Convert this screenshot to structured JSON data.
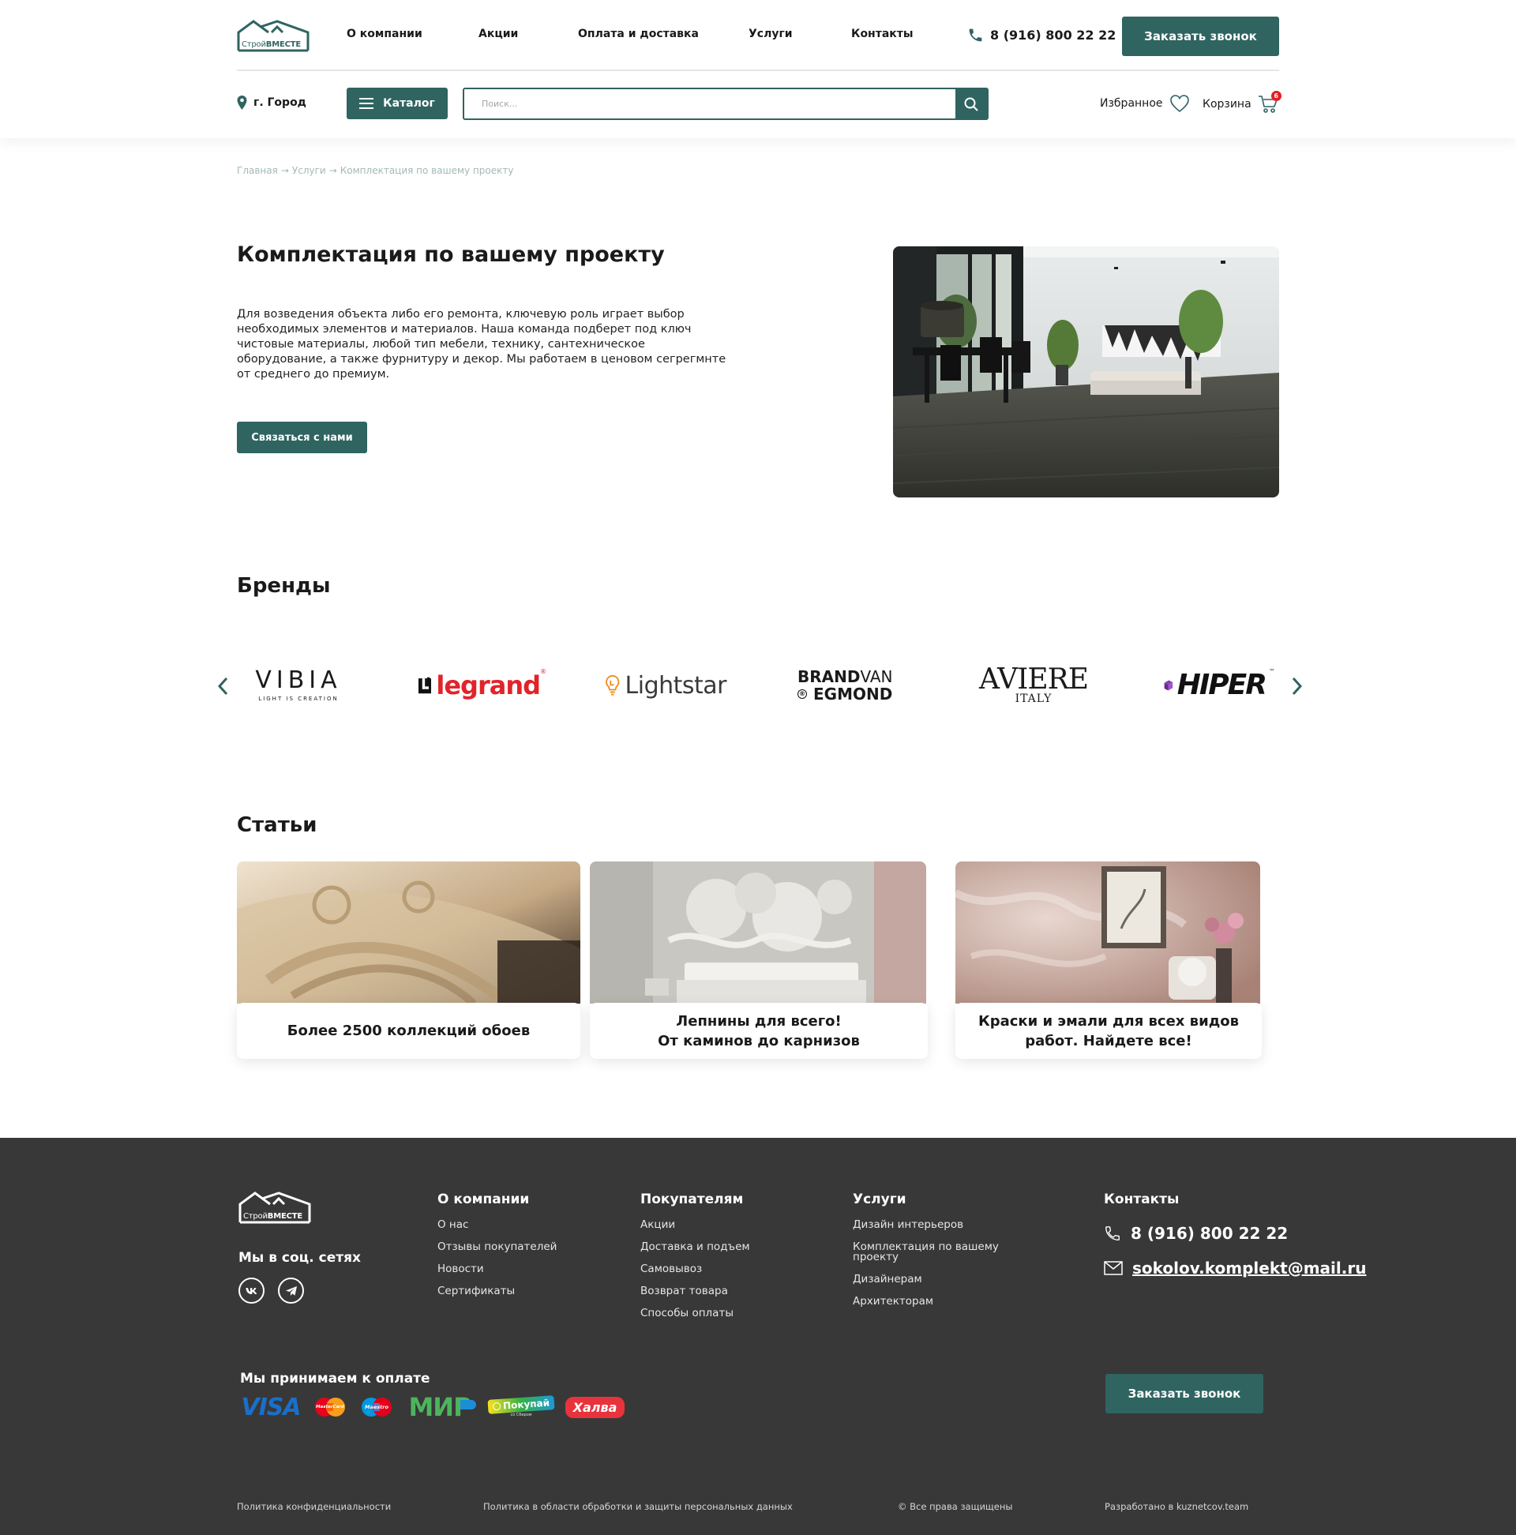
{
  "header": {
    "logo": {
      "part1": "Строй",
      "part2": "ВМЕСТЕ"
    },
    "nav": [
      "О компании",
      "Акции",
      "Оплата и доставка",
      "Услуги",
      "Контакты"
    ],
    "phone": "8 (916) 800 22 22",
    "callback_label": "Заказать звонок",
    "city": "г. Город",
    "catalog_label": "Каталог",
    "search_placeholder": "Поиск...",
    "favorites_label": "Избранное",
    "cart_label": "Корзина",
    "cart_count": "6"
  },
  "breadcrumb": {
    "home": "Главная",
    "sep": "→",
    "services": "Услуги",
    "current": "Комплектация по вашему проекту"
  },
  "hero": {
    "title": "Комплектация по вашему проекту",
    "text": "Для возведения объекта либо его ремонта, ключевую роль играет выбор необходимых элементов и материалов. Наша команда подберет под ключ чистовые материалы, любой тип мебели, технику, сантехническое оборудование, а также фурнитуру и декор. Мы работаем в ценовом сегрегмнте от среднего до премиум.",
    "button": "Связаться с нами"
  },
  "brands": {
    "title": "Бренды",
    "items": {
      "vibia": {
        "name": "VIBIA",
        "tagline": "LIGHT IS CREATION"
      },
      "legrand": {
        "name": "legrand",
        "mark": "®"
      },
      "lightstar": {
        "name": "Lightstar"
      },
      "brandvan": {
        "line1a": "BRAND",
        "line1b": "VAN",
        "line2": "EGMOND",
        "mark": "®"
      },
      "aviere": {
        "name": "AVIERE",
        "sub": "ITALY"
      },
      "hiper": {
        "name": "HIPER",
        "mark": "™"
      }
    }
  },
  "articles": {
    "title": "Статьи",
    "items": [
      {
        "line1": "Более 2500 коллекций обоев",
        "line2": ""
      },
      {
        "line1": "Лепнины для всего!",
        "line2": "От каминов до карнизов"
      },
      {
        "line1": "Краски и эмали для всех видов",
        "line2": "работ. Найдете все!"
      }
    ]
  },
  "footer": {
    "social_title": "Мы в соц. сетях",
    "social": [
      "vk",
      "telegram"
    ],
    "columns": [
      {
        "title": "О компании",
        "links": [
          "О нас",
          "Отзывы покупателей",
          "Новости",
          "Сертификаты"
        ]
      },
      {
        "title": "Покупателям",
        "links": [
          "Акции",
          "Доставка и подъем",
          "Самовывоз",
          "Возврат товара",
          "Способы оплаты"
        ]
      },
      {
        "title": "Услуги",
        "links": [
          "Дизайн интерьеров",
          "Комплектация по вашему",
          "проекту",
          "Дизайнерам",
          "Архитекторам"
        ]
      }
    ],
    "contacts_title": "Контакты",
    "phone": "8 (916) 800 22 22",
    "email": "sokolov.komplekt@mail.ru",
    "payment_title": "Мы принимаем к оплате",
    "payments": {
      "visa": "VISA",
      "mastercard": "MasterCard",
      "maestro": "Maestro",
      "mir": "МИР",
      "pokupay": "Покупай",
      "pokupay_sub": "со Сбером",
      "halva": "Халва"
    },
    "callback_label": "Заказать звонок",
    "bottom": [
      "Политика конфиденциальности",
      "Политика в области обработки и защиты персональных данных",
      "© Все права защищены",
      "Разработано в kuznetcov.team"
    ]
  },
  "colors": {
    "accent": "#2f6461",
    "footer_bg": "#383838",
    "badge": "#e31e24",
    "breadcrumb": "#a3b9b7"
  },
  "icons": [
    "logo-house-icon",
    "phone-icon",
    "location-pin-icon",
    "menu-icon",
    "search-icon",
    "heart-icon",
    "cart-icon",
    "chevron-left-icon",
    "chevron-right-icon",
    "vk-icon",
    "telegram-icon",
    "mail-icon"
  ]
}
